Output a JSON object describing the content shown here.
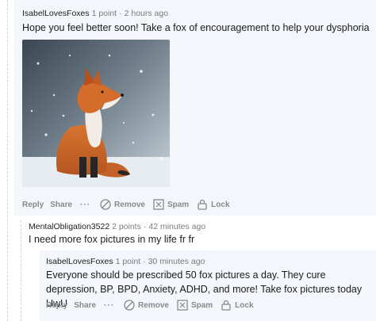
{
  "comments": [
    {
      "author": "IsabelLovesFoxes",
      "points": "1 point",
      "separator": "·",
      "time": "2 hours ago",
      "body": "Hope you feel better soon! Take a fox of encouragement to help your dysphoria",
      "actions": {
        "reply": "Reply",
        "share": "Share",
        "more": "···",
        "remove": "Remove",
        "spam": "Spam",
        "lock": "Lock"
      }
    },
    {
      "author": "MentalObligation3522",
      "points": "2 points",
      "separator": "·",
      "time": "42 minutes ago",
      "body": "I need more fox pictures in my life fr fr"
    },
    {
      "author": "IsabelLovesFoxes",
      "points": "1 point",
      "separator": "·",
      "time": "30 minutes ago",
      "body": "Everyone should be prescribed 50 fox pictures a day. They cure depression, BP, BPD, Anxiety, ADHD, and more! Take fox pictures today UwU",
      "actions": {
        "reply": "Reply",
        "share": "Share",
        "more": "···",
        "remove": "Remove",
        "spam": "Spam",
        "lock": "Lock"
      }
    }
  ],
  "icons": [
    "remove-circle-icon",
    "spam-box-icon",
    "lock-icon"
  ],
  "colors": {
    "comment_bg": "#f3f6fa",
    "meta": "#787c7e",
    "action": "#878a8c",
    "text": "#1c1c1c"
  }
}
